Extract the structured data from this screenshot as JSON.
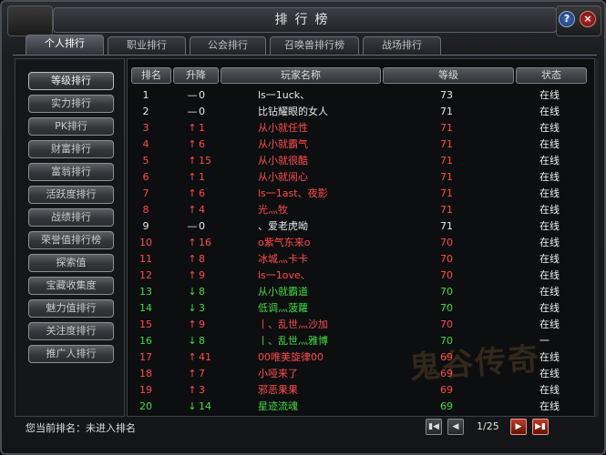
{
  "window": {
    "title": "排行榜"
  },
  "tabs": [
    {
      "label": "个人排行",
      "active": true
    },
    {
      "label": "职业排行",
      "active": false
    },
    {
      "label": "公会排行",
      "active": false
    },
    {
      "label": "召唤兽排行榜",
      "active": false
    },
    {
      "label": "战场排行",
      "active": false
    }
  ],
  "sidebar": [
    {
      "label": "等级排行",
      "active": true
    },
    {
      "label": "实力排行"
    },
    {
      "label": "PK排行"
    },
    {
      "label": "财富排行"
    },
    {
      "label": "富翁排行"
    },
    {
      "label": "活跃度排行"
    },
    {
      "label": "战绩排行"
    },
    {
      "label": "荣誉值排行榜"
    },
    {
      "label": "探索值"
    },
    {
      "label": "宝藏收集度"
    },
    {
      "label": "魅力值排行"
    },
    {
      "label": "关注度排行"
    },
    {
      "label": "推广人排行"
    }
  ],
  "columns": {
    "rank": "排名",
    "change": "升降",
    "name": "玩家名称",
    "level": "等级",
    "status": "状态"
  },
  "rows": [
    {
      "rank": "1",
      "arrow": "—",
      "change": "0",
      "name": "ls一1uck、",
      "level": "73",
      "status": "在线",
      "color": "white"
    },
    {
      "rank": "2",
      "arrow": "—",
      "change": "0",
      "name": "比钻耀眼的女人",
      "level": "71",
      "status": "在线",
      "color": "white"
    },
    {
      "rank": "3",
      "arrow": "↑",
      "change": "1",
      "name": "从小就任性",
      "level": "71",
      "status": "在线",
      "color": "red"
    },
    {
      "rank": "4",
      "arrow": "↑",
      "change": "6",
      "name": "从小就霸气",
      "level": "71",
      "status": "在线",
      "color": "red"
    },
    {
      "rank": "5",
      "arrow": "↑",
      "change": "15",
      "name": "从小就很酷",
      "level": "71",
      "status": "在线",
      "color": "red"
    },
    {
      "rank": "6",
      "arrow": "↑",
      "change": "1",
      "name": "从小就闹心",
      "level": "71",
      "status": "在线",
      "color": "red"
    },
    {
      "rank": "7",
      "arrow": "↑",
      "change": "6",
      "name": "ls一1ast、夜影",
      "level": "71",
      "status": "在线",
      "color": "red"
    },
    {
      "rank": "8",
      "arrow": "↑",
      "change": "4",
      "name": "光灬牧",
      "level": "71",
      "status": "在线",
      "color": "red"
    },
    {
      "rank": "9",
      "arrow": "—",
      "change": "0",
      "name": "、爱老虎呦",
      "level": "71",
      "status": "在线",
      "color": "white"
    },
    {
      "rank": "10",
      "arrow": "↑",
      "change": "16",
      "name": "o紫气东来o",
      "level": "70",
      "status": "在线",
      "color": "red"
    },
    {
      "rank": "11",
      "arrow": "↑",
      "change": "8",
      "name": "冰城灬卡卡",
      "level": "70",
      "status": "在线",
      "color": "red"
    },
    {
      "rank": "12",
      "arrow": "↑",
      "change": "9",
      "name": "ls一1ove、",
      "level": "70",
      "status": "在线",
      "color": "red"
    },
    {
      "rank": "13",
      "arrow": "↓",
      "change": "8",
      "name": "从小就霸道",
      "level": "70",
      "status": "在线",
      "color": "green"
    },
    {
      "rank": "14",
      "arrow": "↓",
      "change": "3",
      "name": "低调灬菠蘿",
      "level": "70",
      "status": "在线",
      "color": "green"
    },
    {
      "rank": "15",
      "arrow": "↑",
      "change": "9",
      "name": "丨、乱世灬沙加",
      "level": "70",
      "status": "在线",
      "color": "red"
    },
    {
      "rank": "16",
      "arrow": "↓",
      "change": "8",
      "name": "丨、乱世灬雅博",
      "level": "70",
      "status": "一",
      "color": "green"
    },
    {
      "rank": "17",
      "arrow": "↑",
      "change": "41",
      "name": "00唯美旋律00",
      "level": "69",
      "status": "在线",
      "color": "red"
    },
    {
      "rank": "18",
      "arrow": "↑",
      "change": "7",
      "name": "小哑来了",
      "level": "69",
      "status": "在线",
      "color": "red"
    },
    {
      "rank": "19",
      "arrow": "↑",
      "change": "3",
      "name": "邪恶果果",
      "level": "69",
      "status": "在线",
      "color": "red"
    },
    {
      "rank": "20",
      "arrow": "↓",
      "change": "14",
      "name": "星迹流魂",
      "level": "69",
      "status": "在线",
      "color": "green"
    }
  ],
  "footer": {
    "my_rank_label": "您当前排名：未进入排名",
    "page": "1/25"
  },
  "watermark": "鬼谷传奇",
  "colors": {
    "up": "#ff4c4c",
    "down": "#44dd44",
    "same": "#e8e8e8"
  }
}
